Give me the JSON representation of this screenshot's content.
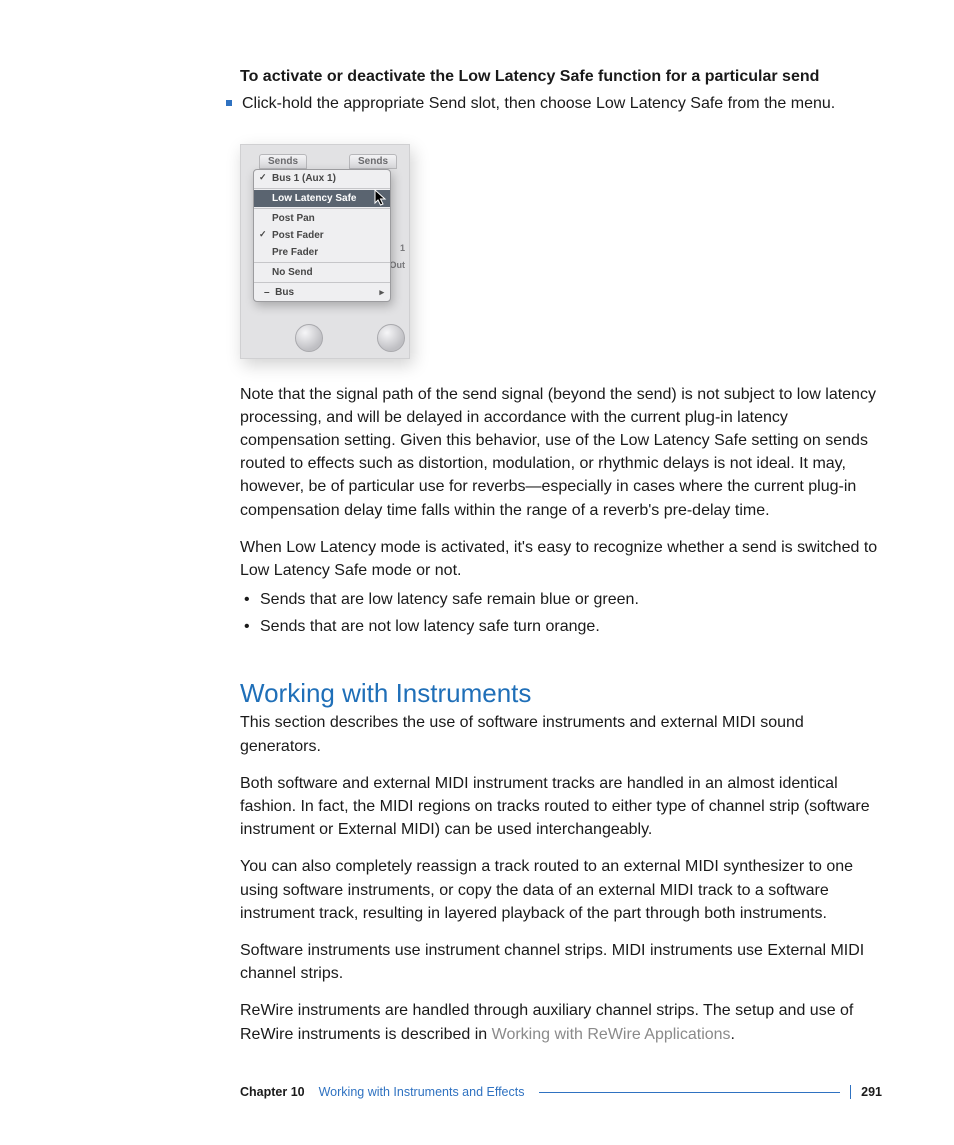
{
  "lead_heading": "To activate or deactivate the Low Latency Safe function for a particular send",
  "lead_bullet": "Click-hold the appropriate Send slot, then choose Low Latency Safe from the menu.",
  "screenshot": {
    "tab_label": "Sends",
    "menu": {
      "bus_item": "Bus 1  (Aux 1)",
      "low_latency": "Low Latency Safe",
      "post_pan": "Post Pan",
      "post_fader": "Post Fader",
      "pre_fader": "Pre Fader",
      "no_send": "No Send",
      "bus_sub": "Bus"
    },
    "bg_labels": {
      "one": "1",
      "out": "Out"
    }
  },
  "para_note": "Note that the signal path of the send signal (beyond the send) is not subject to low latency processing, and will be delayed in accordance with the current plug-in latency compensation setting. Given this behavior, use of the Low Latency Safe setting on sends routed to effects such as distortion, modulation, or rhythmic delays is not ideal. It may, however, be of particular use for reverbs—especially in cases where the current plug-in compensation delay time falls within the range of a reverb's pre-delay time.",
  "para_recognize": "When Low Latency mode is activated, it's easy to recognize whether a send is switched to Low Latency Safe mode or not.",
  "dot1": "Sends that are low latency safe remain blue or green.",
  "dot2": "Sends that are not low latency safe turn orange.",
  "section_heading": "Working with Instruments",
  "sec_p1": "This section describes the use of software instruments and external MIDI sound generators.",
  "sec_p2": "Both software and external MIDI instrument tracks are handled in an almost identical fashion. In fact, the MIDI regions on tracks routed to either type of channel strip (software instrument or External MIDI) can be used interchangeably.",
  "sec_p3": "You can also completely reassign a track routed to an external MIDI synthesizer to one using software instruments, or copy the data of an external MIDI track to a software instrument track, resulting in layered playback of the part through both instruments.",
  "sec_p4": "Software instruments use instrument channel strips. MIDI instruments use External MIDI channel strips.",
  "sec_p5_pre": "ReWire instruments are handled through auxiliary channel strips. The setup and use of ReWire instruments is described in ",
  "sec_p5_link": "Working with ReWire Applications",
  "sec_p5_post": ".",
  "footer": {
    "chapter_label": "Chapter 10",
    "chapter_title": "Working with Instruments and Effects",
    "page_number": "291"
  }
}
